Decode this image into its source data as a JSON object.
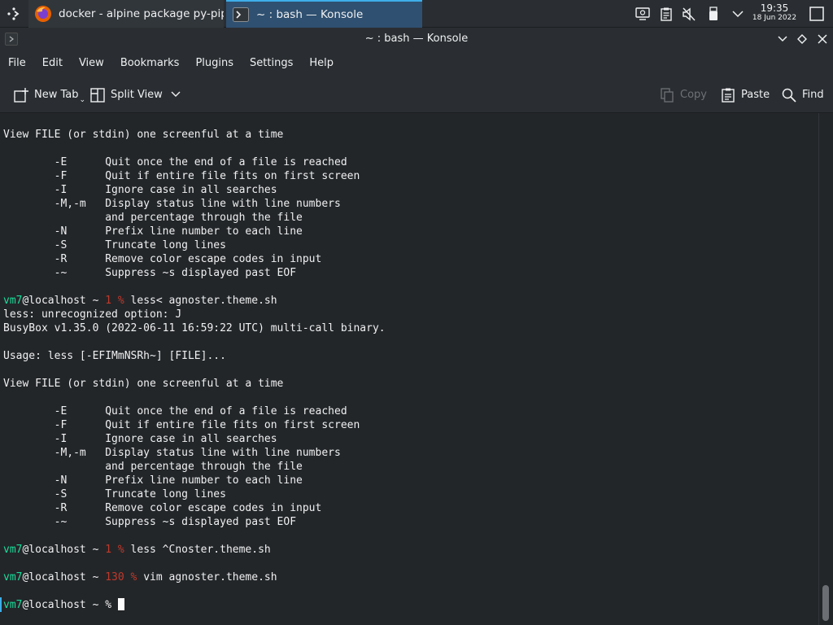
{
  "taskbar": {
    "launcher_icon": "application-launcher-icon",
    "tasks": [
      {
        "label": "docker - alpine package py-pip m...",
        "icon": "firefox-icon"
      },
      {
        "label": "~ : bash — Konsole",
        "icon": "konsole-icon"
      }
    ],
    "tray_icons": [
      "display-config-icon",
      "clipboard-icon",
      "volume-muted-icon",
      "usb-device-icon",
      "chevron-down-icon"
    ],
    "clock": {
      "time": "19:35",
      "date": "18 Jun 2022"
    }
  },
  "window": {
    "title": "~ : bash — Konsole"
  },
  "menubar": {
    "items": [
      "File",
      "Edit",
      "View",
      "Bookmarks",
      "Plugins",
      "Settings",
      "Help"
    ]
  },
  "toolbar": {
    "new_tab": "New Tab",
    "split_view": "Split View",
    "copy": "Copy",
    "paste": "Paste",
    "find": "Find"
  },
  "terminal": {
    "lines": [
      "View FILE (or stdin) one screenful at a time",
      "",
      "        -E      Quit once the end of a file is reached",
      "        -F      Quit if entire file fits on first screen",
      "        -I      Ignore case in all searches",
      "        -M,-m   Display status line with line numbers",
      "                and percentage through the file",
      "        -N      Prefix line number to each line",
      "        -S      Truncate long lines",
      "        -R      Remove color escape codes in input",
      "        -~      Suppress ~s displayed past EOF",
      "",
      "",
      "less: unrecognized option: J",
      "BusyBox v1.35.0 (2022-06-11 16:59:22 UTC) multi-call binary.",
      "",
      "Usage: less [-EFIMmNSRh~] [FILE]...",
      "",
      "View FILE (or stdin) one screenful at a time",
      "",
      "        -E      Quit once the end of a file is reached",
      "        -F      Quit if entire file fits on first screen",
      "        -I      Ignore case in all searches",
      "        -M,-m   Display status line with line numbers",
      "                and percentage through the file",
      "        -N      Prefix line number to each line",
      "        -S      Truncate long lines",
      "        -R      Remove color escape codes in input",
      "        -~      Suppress ~s displayed past EOF"
    ],
    "prompts": [
      {
        "user": "vm7",
        "host": "@localhost ~ ",
        "status": "1 % ",
        "command": "less< agnoster.theme.sh"
      },
      {
        "user": "vm7",
        "host": "@localhost ~ ",
        "status": "1 % ",
        "command": "less ^Cnoster.theme.sh"
      },
      {
        "user": "vm7",
        "host": "@localhost ~ ",
        "status": "130 % ",
        "command": "vim agnoster.theme.sh"
      },
      {
        "user": "vm7",
        "host": "@localhost ~ % ",
        "status": "",
        "command": ""
      }
    ]
  },
  "colors": {
    "accent": "#3daee9",
    "prompt_user": "#1cdc9a",
    "prompt_status": "#c0392b",
    "terminal_bg": "#232629"
  }
}
